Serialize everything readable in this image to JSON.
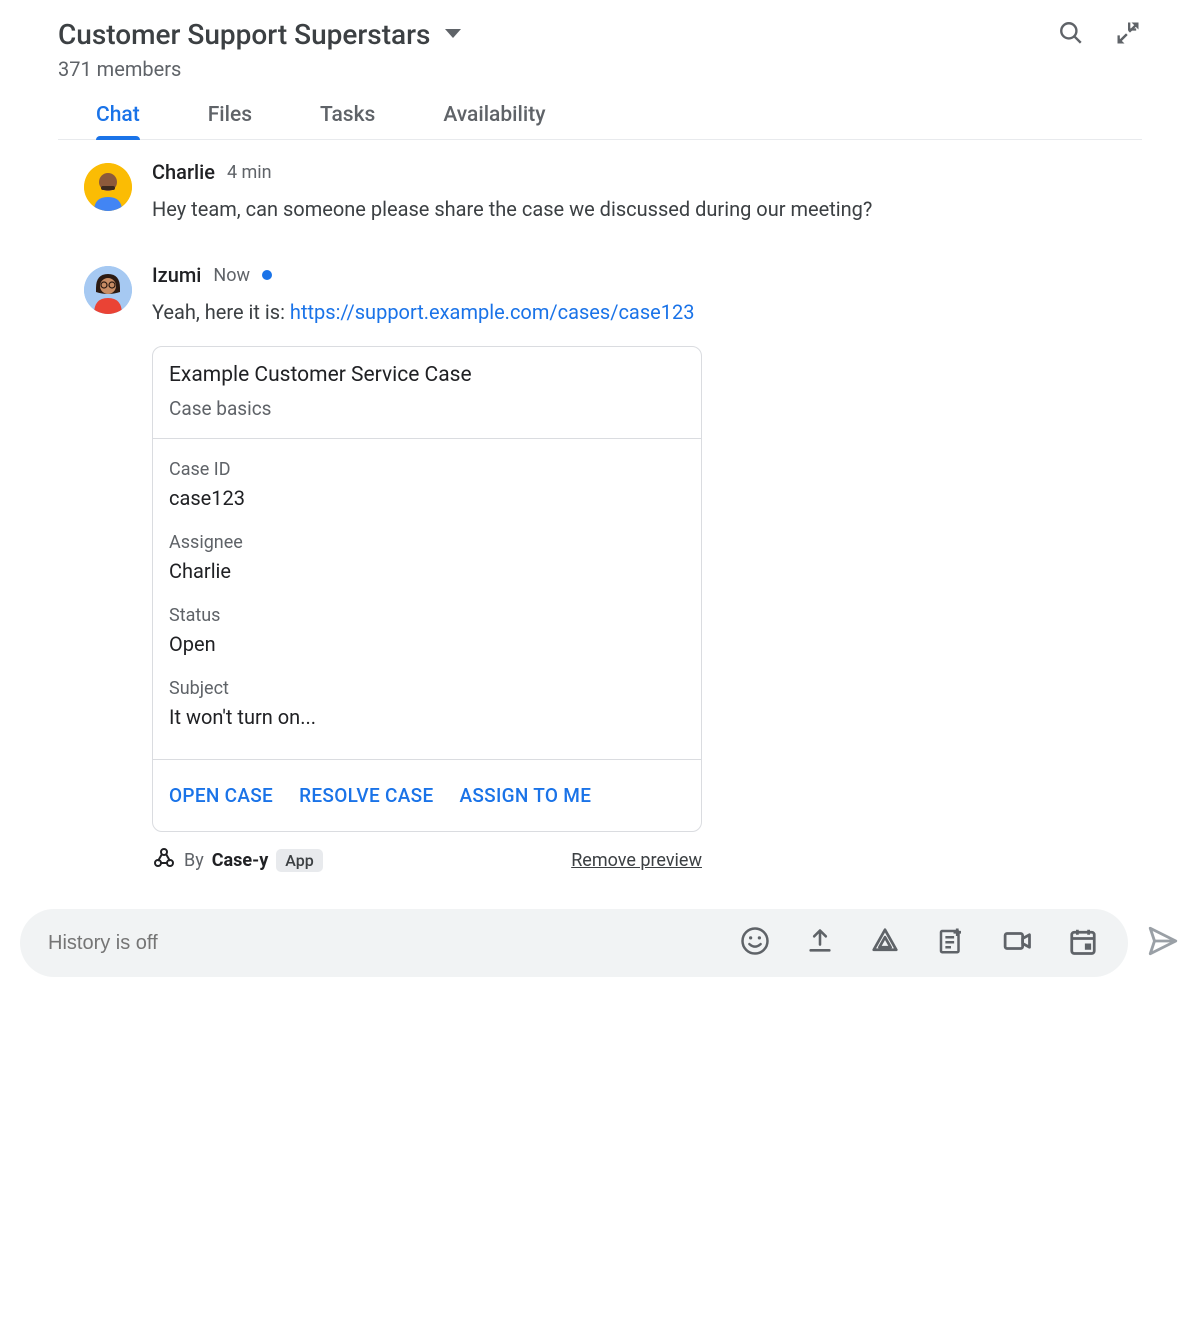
{
  "header": {
    "title": "Customer Support Superstars",
    "member_count": "371 members"
  },
  "tabs": [
    {
      "label": "Chat",
      "active": true
    },
    {
      "label": "Files",
      "active": false
    },
    {
      "label": "Tasks",
      "active": false
    },
    {
      "label": "Availability",
      "active": false
    }
  ],
  "messages": [
    {
      "sender": "Charlie",
      "timestamp": "4 min",
      "text": "Hey team, can someone please share the case we discussed during our meeting?"
    },
    {
      "sender": "Izumi",
      "timestamp": "Now",
      "has_status_dot": true,
      "text_prefix": "Yeah, here it is: ",
      "link": "https://support.example.com/cases/case123",
      "card": {
        "title": "Example Customer Service Case",
        "subtitle": "Case basics",
        "fields": [
          {
            "label": "Case ID",
            "value": "case123"
          },
          {
            "label": "Assignee",
            "value": "Charlie"
          },
          {
            "label": "Status",
            "value": "Open"
          },
          {
            "label": "Subject",
            "value": "It won't turn on..."
          }
        ],
        "actions": [
          "OPEN CASE",
          "RESOLVE CASE",
          "ASSIGN TO ME"
        ]
      },
      "card_footer": {
        "by_prefix": "By",
        "app_name": "Case-y",
        "badge": "App",
        "remove_label": "Remove preview"
      }
    }
  ],
  "composer": {
    "placeholder": "History is off"
  }
}
